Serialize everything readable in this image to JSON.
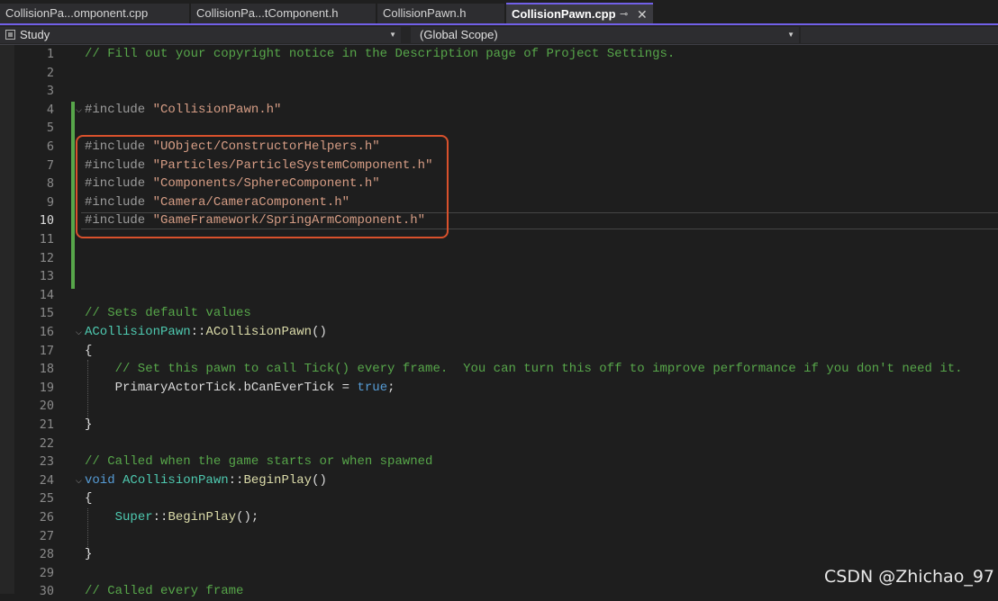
{
  "tabs": [
    {
      "label": "CollisionPa...omponent.cpp"
    },
    {
      "label": "CollisionPa...tComponent.h"
    },
    {
      "label": "CollisionPawn.h"
    },
    {
      "label": "CollisionPawn.cpp",
      "active": true,
      "pin_icon": "pin-icon",
      "close_icon": "close-icon"
    }
  ],
  "navbar": {
    "project": "Study",
    "scope": "(Global Scope)",
    "project_icon": "project-icon",
    "dropdown_icon": "chevron-down-icon"
  },
  "editor": {
    "current_line": 10,
    "lines": [
      {
        "n": "1",
        "text": "// Fill out your copyright notice in the Description page of Project Settings."
      },
      {
        "n": "2",
        "text": ""
      },
      {
        "n": "3",
        "text": ""
      },
      {
        "n": "4",
        "text": "#include \"CollisionPawn.h\""
      },
      {
        "n": "5",
        "text": ""
      },
      {
        "n": "6",
        "text": "#include \"UObject/ConstructorHelpers.h\""
      },
      {
        "n": "7",
        "text": "#include \"Particles/ParticleSystemComponent.h\""
      },
      {
        "n": "8",
        "text": "#include \"Components/SphereComponent.h\""
      },
      {
        "n": "9",
        "text": "#include \"Camera/CameraComponent.h\""
      },
      {
        "n": "10",
        "text": "#include \"GameFramework/SpringArmComponent.h\""
      },
      {
        "n": "11",
        "text": ""
      },
      {
        "n": "12",
        "text": ""
      },
      {
        "n": "13",
        "text": ""
      },
      {
        "n": "14",
        "text": ""
      },
      {
        "n": "15",
        "text": "// Sets default values"
      },
      {
        "n": "16",
        "text": "ACollisionPawn::ACollisionPawn()"
      },
      {
        "n": "17",
        "text": "{"
      },
      {
        "n": "18",
        "text": "    // Set this pawn to call Tick() every frame.  You can turn this off to improve performance if you don't need it."
      },
      {
        "n": "19",
        "text": "    PrimaryActorTick.bCanEverTick = true;"
      },
      {
        "n": "20",
        "text": ""
      },
      {
        "n": "21",
        "text": "}"
      },
      {
        "n": "22",
        "text": ""
      },
      {
        "n": "23",
        "text": "// Called when the game starts or when spawned"
      },
      {
        "n": "24",
        "text": "void ACollisionPawn::BeginPlay()"
      },
      {
        "n": "25",
        "text": "{"
      },
      {
        "n": "26",
        "text": "    Super::BeginPlay();"
      },
      {
        "n": "27",
        "text": ""
      },
      {
        "n": "28",
        "text": "}"
      },
      {
        "n": "29",
        "text": ""
      },
      {
        "n": "30",
        "text": "// Called every frame"
      }
    ]
  },
  "watermark": "CSDN @Zhichao_97",
  "colors": {
    "background": "#1e1e1e",
    "accent": "#7160e8",
    "comment": "#57a64a",
    "string": "#d69d85",
    "keyword": "#569cd6",
    "class": "#4ec9b0",
    "function": "#dcdcaa",
    "highlight_box": "#d9512c"
  }
}
